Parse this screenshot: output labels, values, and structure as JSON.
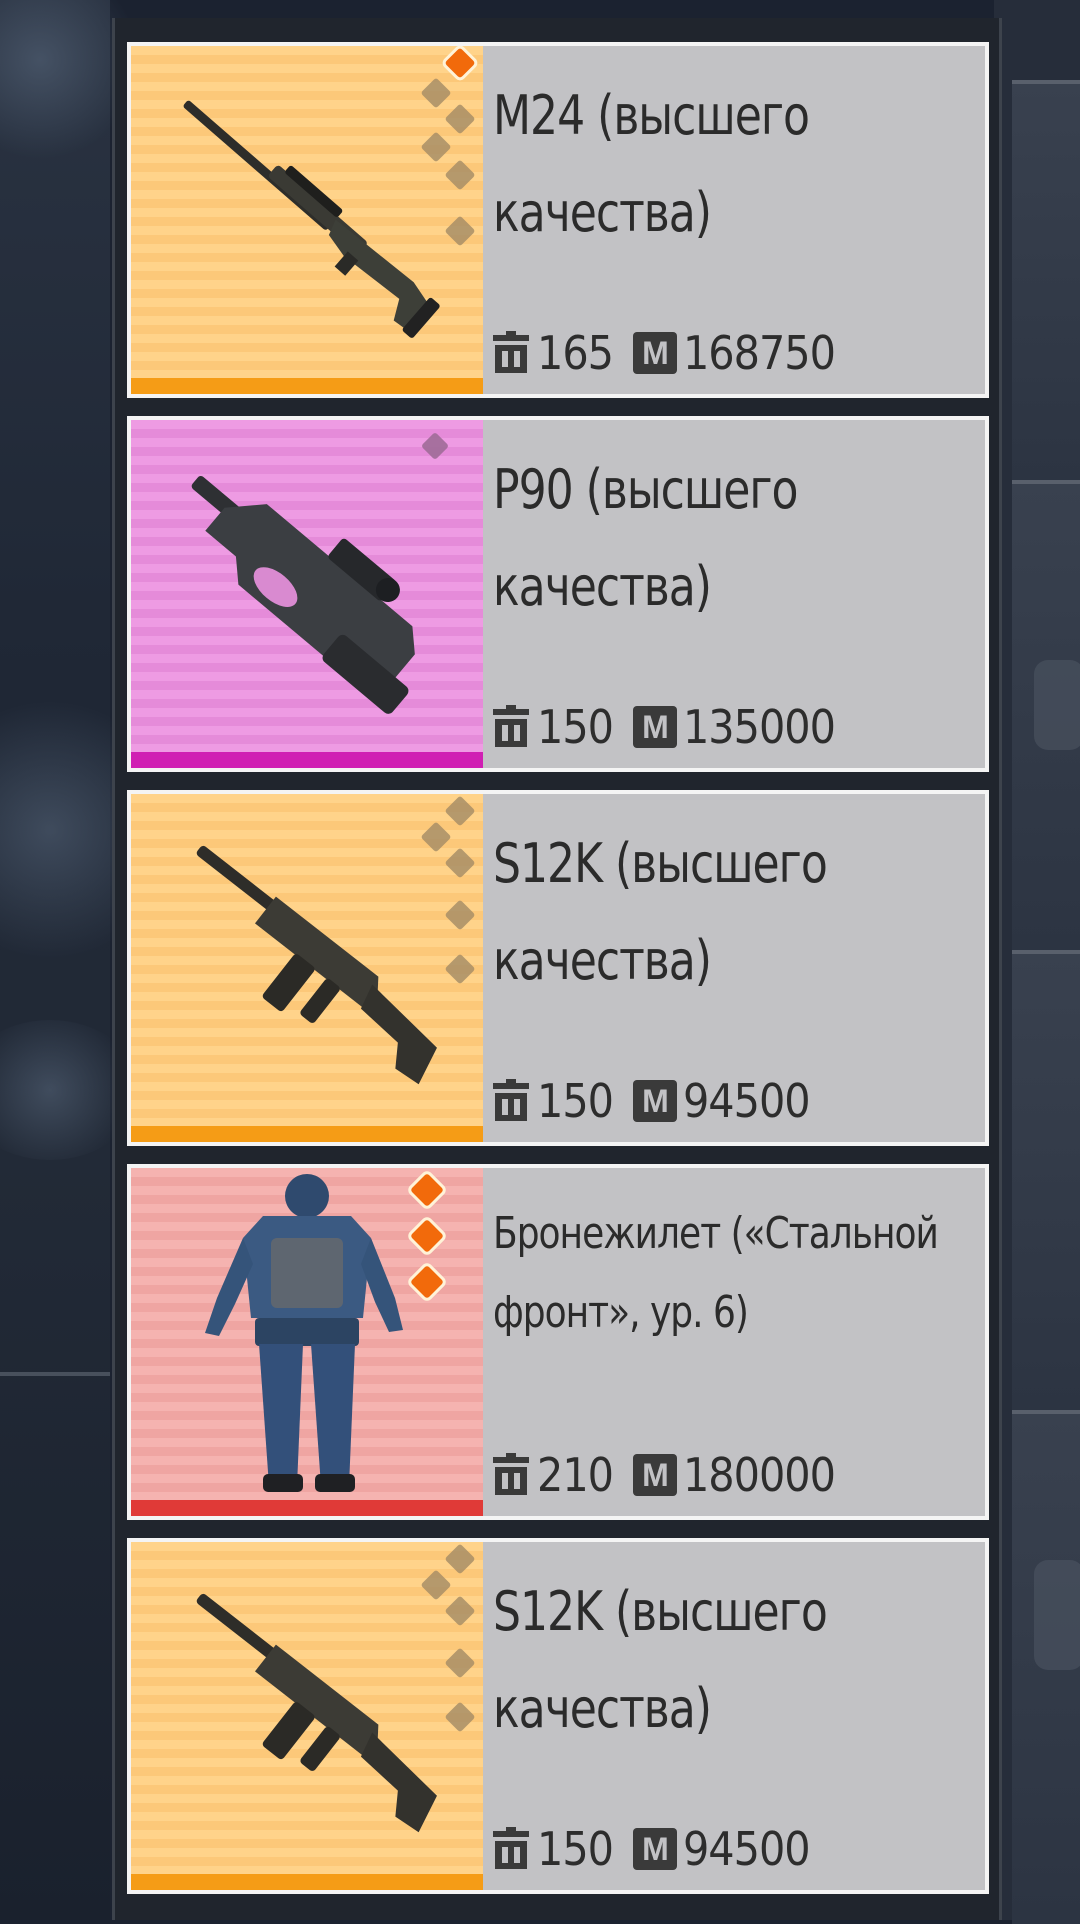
{
  "items": [
    {
      "name": "M24 (высшего качества)",
      "weight": "165",
      "price": "168750",
      "rarity": "legendary",
      "icon": "sniper-rifle-icon",
      "grade": {
        "lit": 1,
        "total": 5
      }
    },
    {
      "name": "P90 (высшего качества)",
      "weight": "150",
      "price": "135000",
      "rarity": "epic",
      "icon": "smg-p90-icon",
      "grade": {
        "lit": 0,
        "total": 1
      }
    },
    {
      "name": "S12K (высшего качества)",
      "weight": "150",
      "price": "94500",
      "rarity": "legendary",
      "icon": "shotgun-icon",
      "grade": {
        "lit": 0,
        "total": 5
      }
    },
    {
      "name": "Бронежилет («Стальной фронт», ур. 6)",
      "weight": "210",
      "price": "180000",
      "rarity": "red",
      "icon": "armor-suit-icon",
      "grade": {
        "lit": 3,
        "total": 3
      }
    },
    {
      "name": "S12K (высшего качества)",
      "weight": "150",
      "price": "94500",
      "rarity": "legendary",
      "icon": "shotgun-icon",
      "grade": {
        "lit": 0,
        "total": 5
      }
    }
  ],
  "money_symbol": "M",
  "colors": {
    "legendary": "#f59c16",
    "epic": "#d01fb3",
    "red": "#e03a37",
    "info_bg": "#c2c2c5"
  }
}
